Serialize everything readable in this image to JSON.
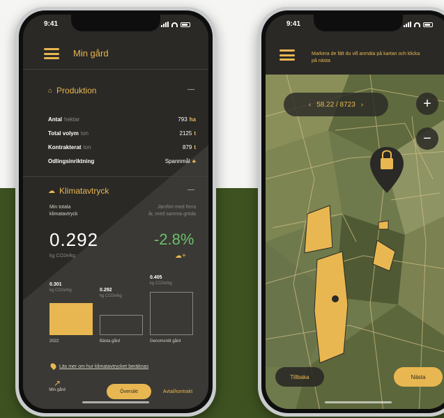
{
  "left_phone": {
    "status_time": "9:41",
    "header_title": "Min gård",
    "production": {
      "title": "Produktion",
      "rows": [
        {
          "label": "Antal",
          "sub": "hektar",
          "value": "793",
          "unit": "ha"
        },
        {
          "label": "Total volym",
          "sub": "ton",
          "value": "2125",
          "unit": "t"
        },
        {
          "label": "Kontrakterat",
          "sub": "ton",
          "value": "879",
          "unit": "t"
        },
        {
          "label": "Odlingsinriktning",
          "sub": "",
          "value": "Spannmål",
          "unit": ""
        }
      ]
    },
    "climate": {
      "title": "Klimatavtryck",
      "left_caption": [
        "Min totala",
        "klimatavtryck"
      ],
      "right_caption": [
        "Jämfört med förra",
        "år, med samma gröda"
      ],
      "value": "0.292",
      "value_unit": "kg CO2e/kg",
      "change": "-2.8%",
      "bars": [
        {
          "value": "0.301",
          "sub": "kg CO2e/kg",
          "caption": "2022",
          "fraction": 0.74
        },
        {
          "value": "0.292",
          "sub": "kg CO2e/kg",
          "caption": "Bästa gård",
          "fraction": 0.46
        },
        {
          "value": "0.405",
          "sub": "kg CO2e/kg",
          "caption": "Genomsnitt gård",
          "fraction": 1.0
        }
      ]
    },
    "link_text": "Läs mer om hur klimatavtrycket beräknas",
    "bottom_nav": {
      "home_label": "Min gård",
      "active_pill": "Översikt",
      "ghost_pill": "Avtal/kontrakt"
    }
  },
  "right_phone": {
    "status_time": "9:41",
    "header_text": "Markera de fält du vill anmäla på kartan och klicka på nästa",
    "coordinates": "58.22 / 8723",
    "zoom_in": "+",
    "zoom_out": "−",
    "back_button": "Tillbaka",
    "next_button": "Nästa"
  },
  "colors": {
    "accent": "#e9b751",
    "dark_bg": "#2a2926",
    "positive": "#6cc16b",
    "page_green": "#3d5220"
  }
}
